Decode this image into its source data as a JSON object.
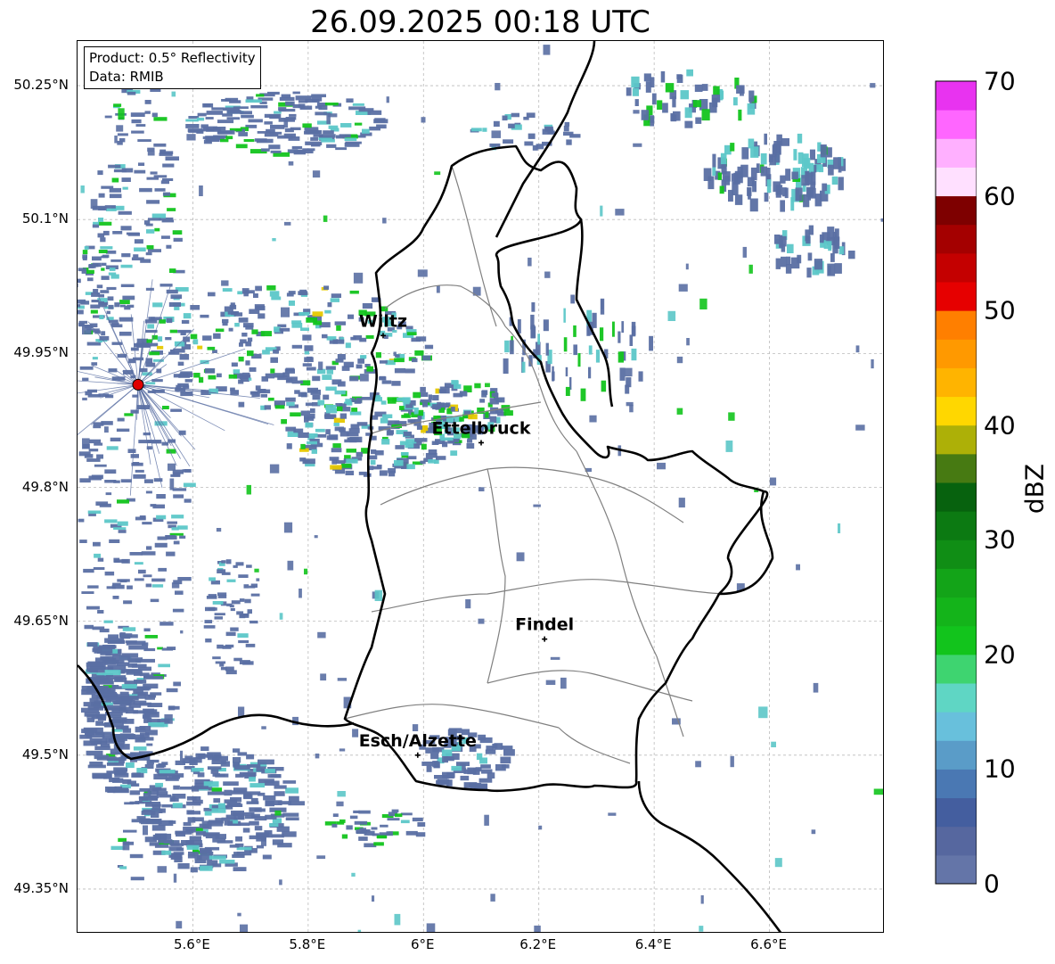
{
  "title": "26.09.2025 00:18 UTC",
  "info": {
    "product": "Product: 0.5° Reflectivity",
    "source": "Data: RMIB"
  },
  "axes": {
    "lon_range": [
      5.4,
      6.8
    ],
    "lat_range": [
      49.3,
      50.3
    ],
    "lat_ticks": [
      {
        "value": 50.25,
        "label": "50.25°N"
      },
      {
        "value": 50.1,
        "label": "50.1°N"
      },
      {
        "value": 49.95,
        "label": "49.95°N"
      },
      {
        "value": 49.8,
        "label": "49.8°N"
      },
      {
        "value": 49.65,
        "label": "49.65°N"
      },
      {
        "value": 49.5,
        "label": "49.5°N"
      },
      {
        "value": 49.35,
        "label": "49.35°N"
      }
    ],
    "lon_ticks": [
      {
        "value": 5.6,
        "label": "5.6°E"
      },
      {
        "value": 5.8,
        "label": "5.8°E"
      },
      {
        "value": 6.0,
        "label": "6°E"
      },
      {
        "value": 6.2,
        "label": "6.2°E"
      },
      {
        "value": 6.4,
        "label": "6.4°E"
      },
      {
        "value": 6.6,
        "label": "6.6°E"
      }
    ],
    "gridlines": true
  },
  "cities": [
    {
      "name": "Wiltz",
      "lon": 5.93,
      "lat": 49.97
    },
    {
      "name": "Ettelbruck",
      "lon": 6.1,
      "lat": 49.85
    },
    {
      "name": "Findel",
      "lon": 6.21,
      "lat": 49.63
    },
    {
      "name": "Esch/Alzette",
      "lon": 5.99,
      "lat": 49.5
    }
  ],
  "radar_site": {
    "lon": 5.505,
    "lat": 49.915,
    "color": "#e00000"
  },
  "colorbar": {
    "label": "dBZ",
    "min": 0,
    "max": 70,
    "ticks": [
      {
        "value": 70,
        "label": "70"
      },
      {
        "value": 60,
        "label": "60"
      },
      {
        "value": 50,
        "label": "50"
      },
      {
        "value": 40,
        "label": "40"
      },
      {
        "value": 30,
        "label": "30"
      },
      {
        "value": 20,
        "label": "20"
      },
      {
        "value": 10,
        "label": "10"
      },
      {
        "value": 0,
        "label": "0"
      }
    ],
    "colors": [
      "#6475a8",
      "#56679f",
      "#445e9f",
      "#4a78b3",
      "#5a9cc8",
      "#68c0dc",
      "#5fd6c4",
      "#3ed470",
      "#12c41c",
      "#14b41a",
      "#13a418",
      "#108e15",
      "#0c7a12",
      "#07620e",
      "#477a12",
      "#adb007",
      "#ffd700",
      "#ffb400",
      "#ff9900",
      "#ff7f00",
      "#e60000",
      "#c40000",
      "#a40000",
      "#7e0000",
      "#ffe0ff",
      "#ffb0ff",
      "#ff66ff",
      "#e833f0"
    ]
  },
  "border_colors": {
    "country": "#000000",
    "canton": "#808080"
  },
  "echo_colors": {
    "base": "#5a6fa3",
    "teal": "#5cc7c8",
    "green": "#12c41c",
    "yellow": "#e6c800"
  }
}
